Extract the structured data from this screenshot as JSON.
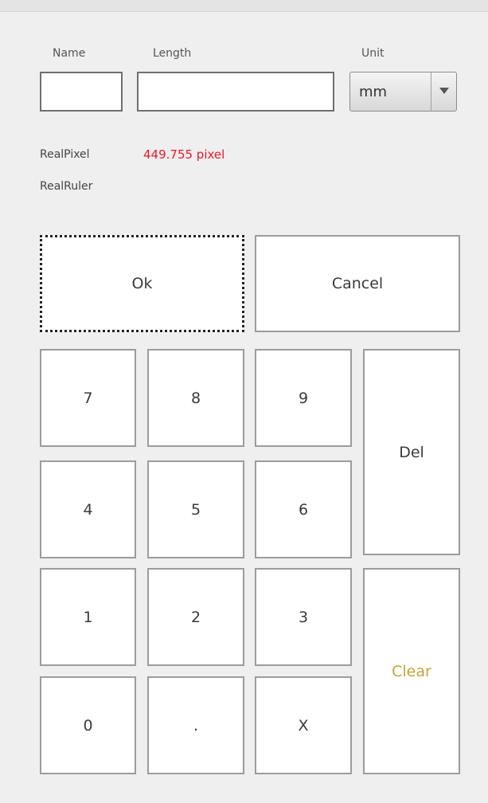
{
  "form": {
    "name_label": "Name",
    "length_label": "Length",
    "unit_label": "Unit",
    "name_value": "",
    "length_value": "",
    "unit_value": "mm"
  },
  "info": {
    "real_pixel_label": "RealPixel",
    "real_pixel_value": "449.755 pixel",
    "real_ruler_label": "RealRuler",
    "real_pixel_value_color": "#e8182a"
  },
  "actions": {
    "ok_label": "Ok",
    "cancel_label": "Cancel"
  },
  "keypad": {
    "k7": "7",
    "k8": "8",
    "k9": "9",
    "k4": "4",
    "k5": "5",
    "k6": "6",
    "k1": "1",
    "k2": "2",
    "k3": "3",
    "k0": "0",
    "dot": ".",
    "x": "X",
    "del": "Del",
    "clear": "Clear",
    "clear_color": "#c8a23b"
  }
}
